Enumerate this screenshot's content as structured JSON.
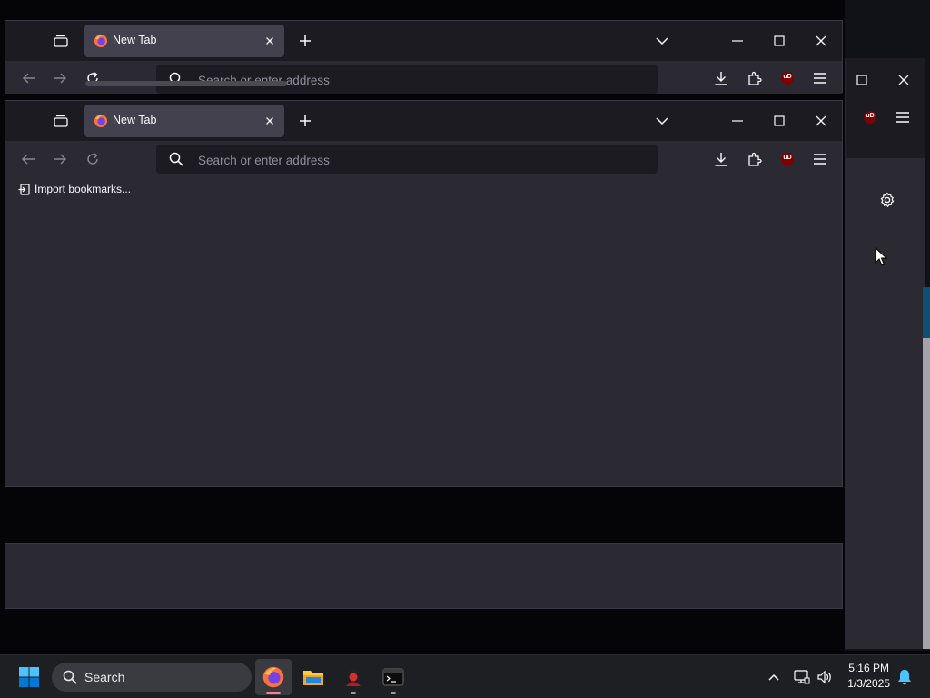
{
  "browser": {
    "tab_title": "New Tab",
    "url_placeholder": "Search or enter address",
    "bookmarks_bar": {
      "import_label": "Import bookmarks..."
    },
    "ublock_badge": "uD"
  },
  "background_window": {
    "tab_title": "New Tab",
    "url_placeholder": "Search or enter address"
  },
  "taskbar": {
    "search_label": "Search",
    "clock_time": "5:16 PM",
    "clock_date": "1/3/2025"
  },
  "colors": {
    "toolbar_bg": "#2b2a33",
    "tabbar_bg": "#1c1b22",
    "selected_tab_bg": "#42414d",
    "taskbar_bg": "#1e1f23",
    "windows_accent": "#0078d4",
    "ublock_red": "#800000"
  }
}
